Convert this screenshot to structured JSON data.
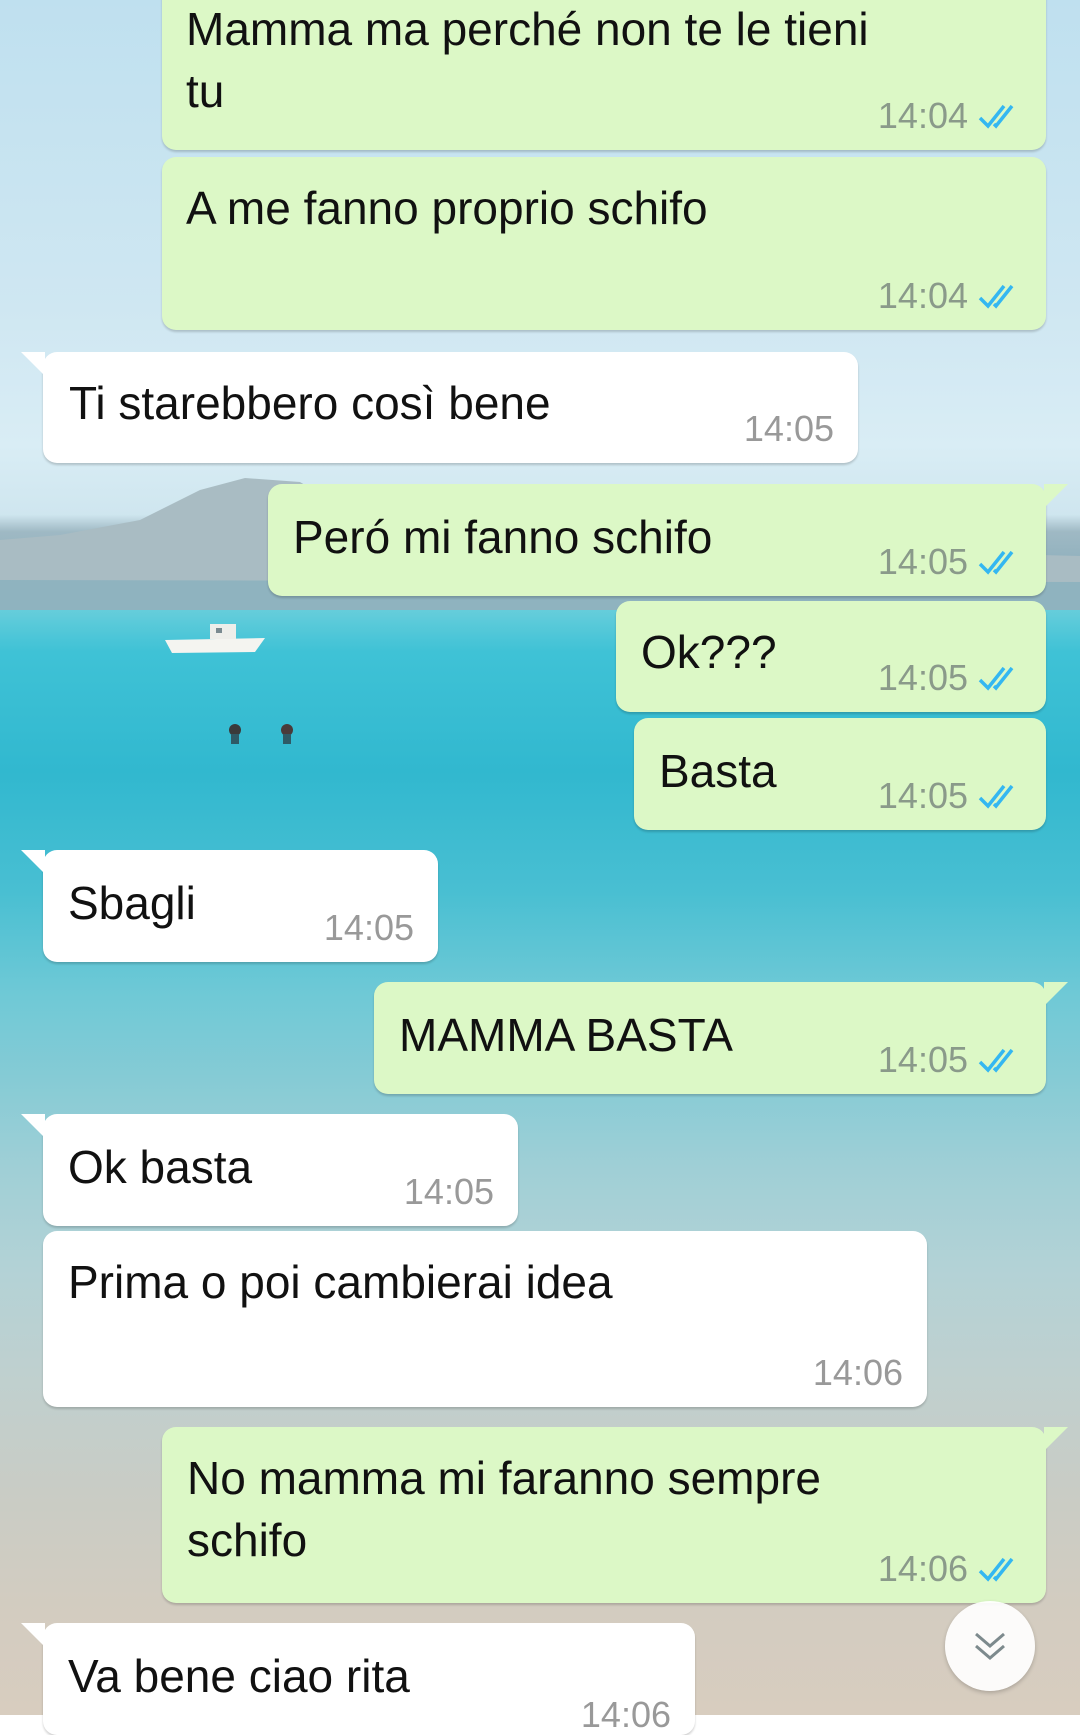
{
  "messages": [
    {
      "text": "Mamma ma perché non te le tieni\ntu",
      "time": "14:04",
      "dir": "out"
    },
    {
      "text": "A me fanno proprio schifo",
      "time": "14:04",
      "dir": "out"
    },
    {
      "text": "Ti starebbero così bene",
      "time": "14:05",
      "dir": "in"
    },
    {
      "text": "Peró mi fanno schifo",
      "time": "14:05",
      "dir": "out"
    },
    {
      "text": "Ok???",
      "time": "14:05",
      "dir": "out"
    },
    {
      "text": "Basta",
      "time": "14:05",
      "dir": "out"
    },
    {
      "text": "Sbagli",
      "time": "14:05",
      "dir": "in"
    },
    {
      "text": "MAMMA BASTA",
      "time": "14:05",
      "dir": "out"
    },
    {
      "text": "Ok basta",
      "time": "14:05",
      "dir": "in"
    },
    {
      "text": "Prima o poi cambierai idea",
      "time": "14:06",
      "dir": "in"
    },
    {
      "text": "No mamma mi faranno sempre\nschifo",
      "time": "14:06",
      "dir": "out"
    },
    {
      "text": "Va bene ciao rita",
      "time": "14:06",
      "dir": "in"
    }
  ],
  "colors": {
    "outgoing_bubble": "#dcf8c6",
    "incoming_bubble": "#ffffff",
    "read_ticks": "#34b7f1"
  },
  "icons": {
    "read_receipt": "double-check-icon",
    "scroll_down": "chevron-double-down-icon"
  }
}
